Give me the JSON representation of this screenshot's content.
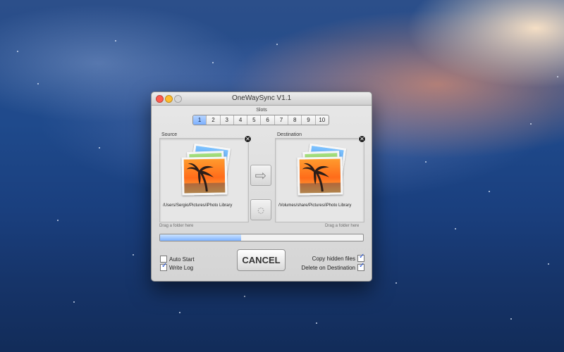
{
  "window": {
    "title": "OneWaySync V1.1"
  },
  "slots": {
    "label": "Slots",
    "items": [
      "1",
      "2",
      "3",
      "4",
      "5",
      "6",
      "7",
      "8",
      "9",
      "10"
    ],
    "selected": "1"
  },
  "source": {
    "label": "Source",
    "path": "/Users/Sergio/Pictures/iPhoto Library",
    "drag_hint": "Drag a folder here",
    "remove_icon": "close-icon"
  },
  "destination": {
    "label": "Destination",
    "path": "/Volumes/share/Pictures/iPhoto Library",
    "drag_hint": "Drag a folder here",
    "remove_icon": "close-icon"
  },
  "actions": {
    "sync_arrow_icon": "arrow-right-icon",
    "spinner_icon": "spinner-icon"
  },
  "progress": {
    "value_fraction": 0.4
  },
  "options": {
    "auto_start": "Auto Start",
    "write_log": "Write Log",
    "copy_hidden_files": "Copy hidden files",
    "delete_on_destination": "Delete on Destination"
  },
  "buttons": {
    "cancel": "CANCEL"
  },
  "colors": {
    "progress_fill": "#7fb2ff",
    "close_red": "#ff5b4f",
    "min_yellow": "#ffbd2e",
    "zoom_gray": "#d8d8d8"
  }
}
